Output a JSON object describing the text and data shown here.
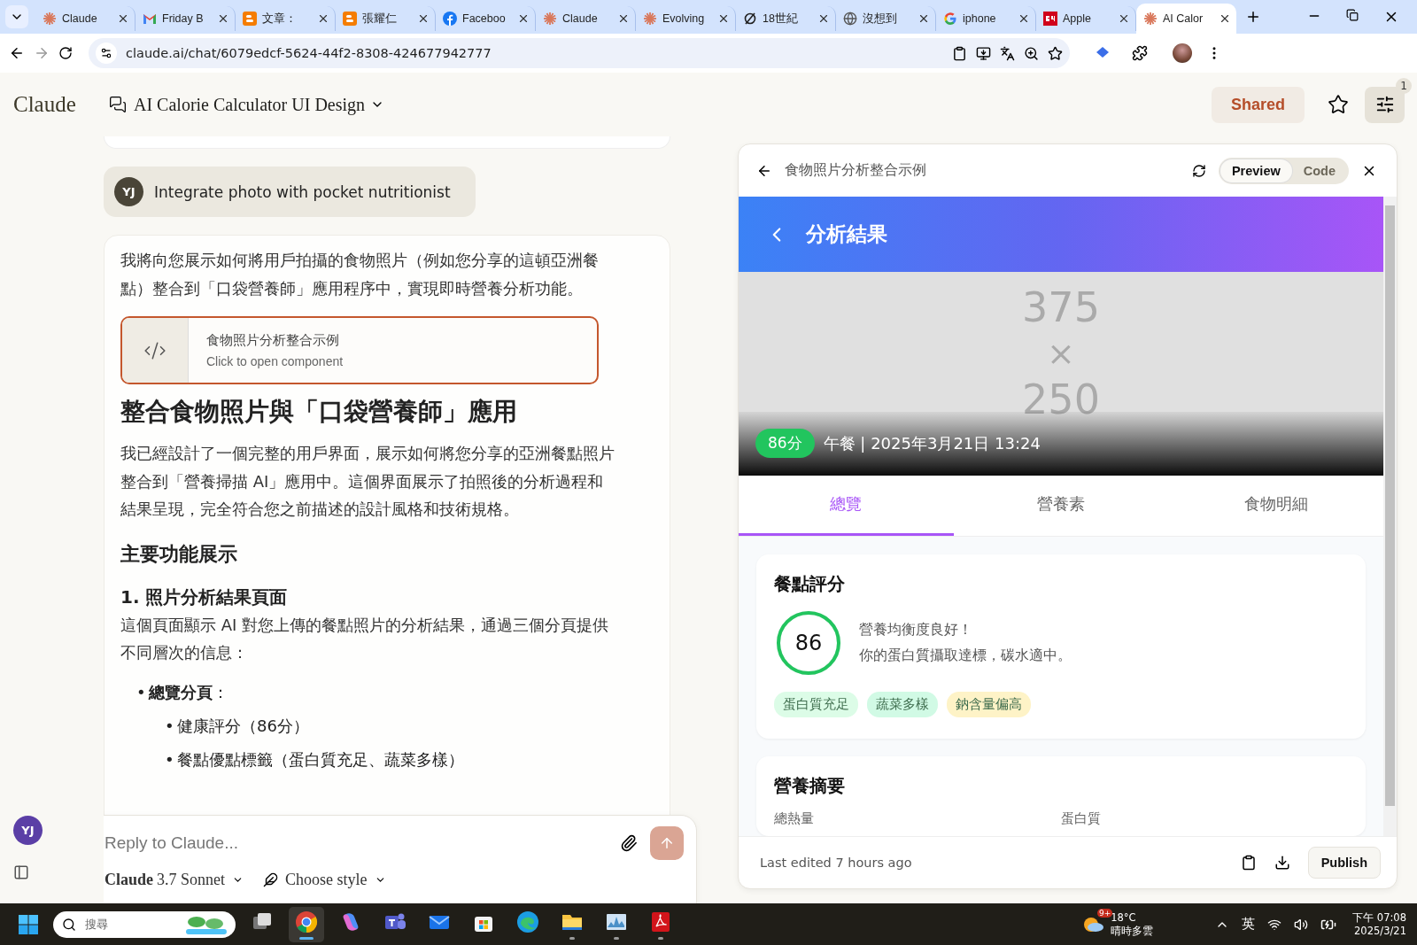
{
  "browser": {
    "tabs": [
      {
        "title": "Claude",
        "kind": "claude",
        "selected": false
      },
      {
        "title": "Friday B",
        "kind": "gmail",
        "selected": false
      },
      {
        "title": "文章：",
        "kind": "blogger",
        "selected": false
      },
      {
        "title": "張耀仁",
        "kind": "blogger",
        "selected": false
      },
      {
        "title": "Faceboo",
        "kind": "facebook",
        "selected": false
      },
      {
        "title": "Claude",
        "kind": "claude",
        "selected": false
      },
      {
        "title": "Evolving",
        "kind": "claude",
        "selected": false
      },
      {
        "title": "18世紀",
        "kind": "ring",
        "selected": false
      },
      {
        "title": "沒想到",
        "kind": "globe",
        "selected": false
      },
      {
        "title": "iphone",
        "kind": "google",
        "selected": false
      },
      {
        "title": "Apple",
        "kind": "news",
        "selected": false
      },
      {
        "title": "AI Calor",
        "kind": "claude",
        "selected": true
      }
    ],
    "url": "claude.ai/chat/6079edcf-5624-44f2-8308-424677942777"
  },
  "header": {
    "logo": "Claude",
    "chat_title": "AI Calorie Calculator UI Design",
    "shared_button": "Shared",
    "settings_badge": "1"
  },
  "user_message": {
    "avatar": "YJ",
    "text": "Integrate photo with pocket nutritionist"
  },
  "assistant_message": {
    "blocks": [
      {
        "kind": "paragraph",
        "text": "我將向您展示如何將用戶拍攝的食物照片（例如您分享的這頓亞洲餐點）整合到「口袋營養師」應用程序中，實現即時營養分析功能。"
      },
      {
        "kind": "artifact",
        "title": "食物照片分析整合示例",
        "subtitle": "Click to open component"
      },
      {
        "kind": "heading1",
        "text": "整合食物照片與「口袋營養師」應用"
      },
      {
        "kind": "paragraph",
        "text": "我已經設計了一個完整的用戶界面，展示如何將您分享的亞洲餐點照片整合到「營養掃描 AI」應用中。這個界面展示了拍照後的分析過程和結果呈現，完全符合您之前描述的設計風格和技術規格。"
      },
      {
        "kind": "heading2",
        "text": "主要功能展示"
      },
      {
        "kind": "heading3",
        "text": "1. 照片分析結果頁面"
      },
      {
        "kind": "paragraph",
        "text": "這個頁面顯示 AI 對您上傳的餐點照片的分析結果，通過三個分頁提供不同層次的信息："
      },
      {
        "kind": "list",
        "items": [
          {
            "marker": "•",
            "text": "**總覽分頁**：",
            "children": [
              {
                "marker": "•",
                "text": "健康評分（86分）"
              },
              {
                "marker": "•",
                "text": "餐點優點標籤（蛋白質充足、蔬菜多樣）"
              }
            ]
          }
        ]
      }
    ]
  },
  "composer": {
    "placeholder": "Reply to Claude...",
    "model_brand": "Claude",
    "model_version": "3.7 Sonnet",
    "style": "Choose style"
  },
  "sidebar": {
    "avatar": "YJ"
  },
  "artifact_panel": {
    "title": "食物照片分析整合示例",
    "view_tabs": [
      {
        "label": "Preview",
        "selected": true
      },
      {
        "label": "Code",
        "selected": false
      }
    ],
    "app": {
      "header_title": "分析結果",
      "photo": {
        "lines": [
          "375",
          "×",
          "250"
        ]
      },
      "score_badge": "86分",
      "meal_info": "午餐 | 2025年3月21日 13:24",
      "tabs": [
        {
          "label": "總覽",
          "selected": true
        },
        {
          "label": "營養素",
          "selected": false
        },
        {
          "label": "食物明細",
          "selected": false
        }
      ],
      "score_card": {
        "title": "餐點評分",
        "score": "86",
        "headline": "營養均衡度良好！",
        "detail": "你的蛋白質攝取達標，碳水適中。",
        "tags": [
          {
            "label": "蛋白質充足",
            "color": "#dcfce7"
          },
          {
            "label": "蔬菜多樣",
            "color": "#d1fae5"
          },
          {
            "label": "鈉含量偏高",
            "color": "#fef3c7"
          }
        ]
      },
      "summary_card": {
        "title": "營養摘要",
        "labels": [
          "總熱量",
          "蛋白質"
        ]
      }
    },
    "footer": {
      "last_edited": "Last edited 7 hours ago",
      "publish_button": "Publish"
    }
  },
  "taskbar": {
    "search_placeholder": "搜尋",
    "apps": [
      {
        "kind": "taskview",
        "running": false,
        "selected": false
      },
      {
        "kind": "browser",
        "running": true,
        "selected": true
      },
      {
        "kind": "copilot",
        "running": false,
        "selected": false
      },
      {
        "kind": "teams",
        "running": false,
        "selected": false
      },
      {
        "kind": "mail",
        "running": false,
        "selected": false
      },
      {
        "kind": "store",
        "running": false,
        "selected": false
      },
      {
        "kind": "edge",
        "running": false,
        "selected": false
      },
      {
        "kind": "folder",
        "running": true,
        "selected": false
      },
      {
        "kind": "monitor",
        "running": true,
        "selected": false
      },
      {
        "kind": "pdf",
        "running": true,
        "selected": false
      }
    ],
    "weather_badge": "9+",
    "temperature": "18°C",
    "weather": "晴時多雲",
    "ime": "英",
    "time": "下午 07:08",
    "date": "2025/3/21"
  }
}
